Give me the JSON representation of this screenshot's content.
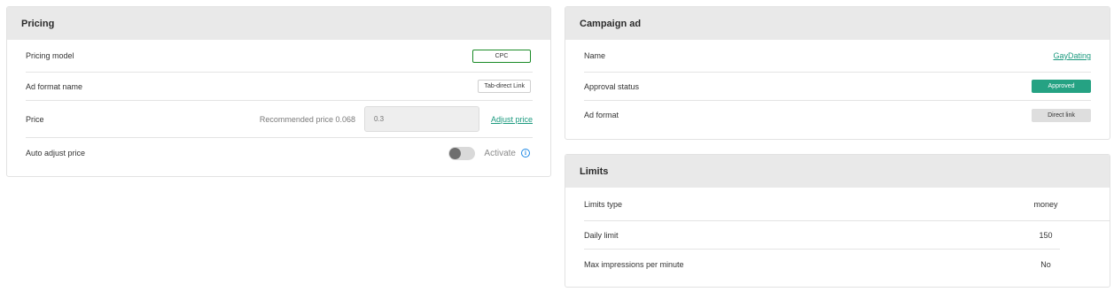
{
  "pricing": {
    "title": "Pricing",
    "rows": {
      "model_label": "Pricing model",
      "model_value": "CPC",
      "format_label": "Ad format name",
      "format_value": "Tab-direct Link",
      "price_label": "Price",
      "recommended": "Recommended price 0.068",
      "price_placeholder": "0.3",
      "adjust_link": "Adjust price",
      "auto_label": "Auto adjust price",
      "activate": "Activate",
      "auto_enabled": false
    }
  },
  "campaign": {
    "title": "Campaign ad",
    "name_label": "Name",
    "name_value": "GayDating",
    "approval_label": "Approval status",
    "approval_value": "Approved",
    "format_label": "Ad format",
    "format_value": "Direct link"
  },
  "limits": {
    "title": "Limits",
    "type_label": "Limits type",
    "type_value": "money",
    "daily_label": "Daily limit",
    "daily_value": "150",
    "impressions_label": "Max impressions per minute",
    "impressions_value": "No"
  },
  "colors": {
    "accent": "#25a283",
    "link": "#1c9a7f",
    "cpc_border": "#1a8b27",
    "info": "#1e88e5",
    "header_bg": "#e9e9e9"
  },
  "icons": [
    "info-icon"
  ]
}
